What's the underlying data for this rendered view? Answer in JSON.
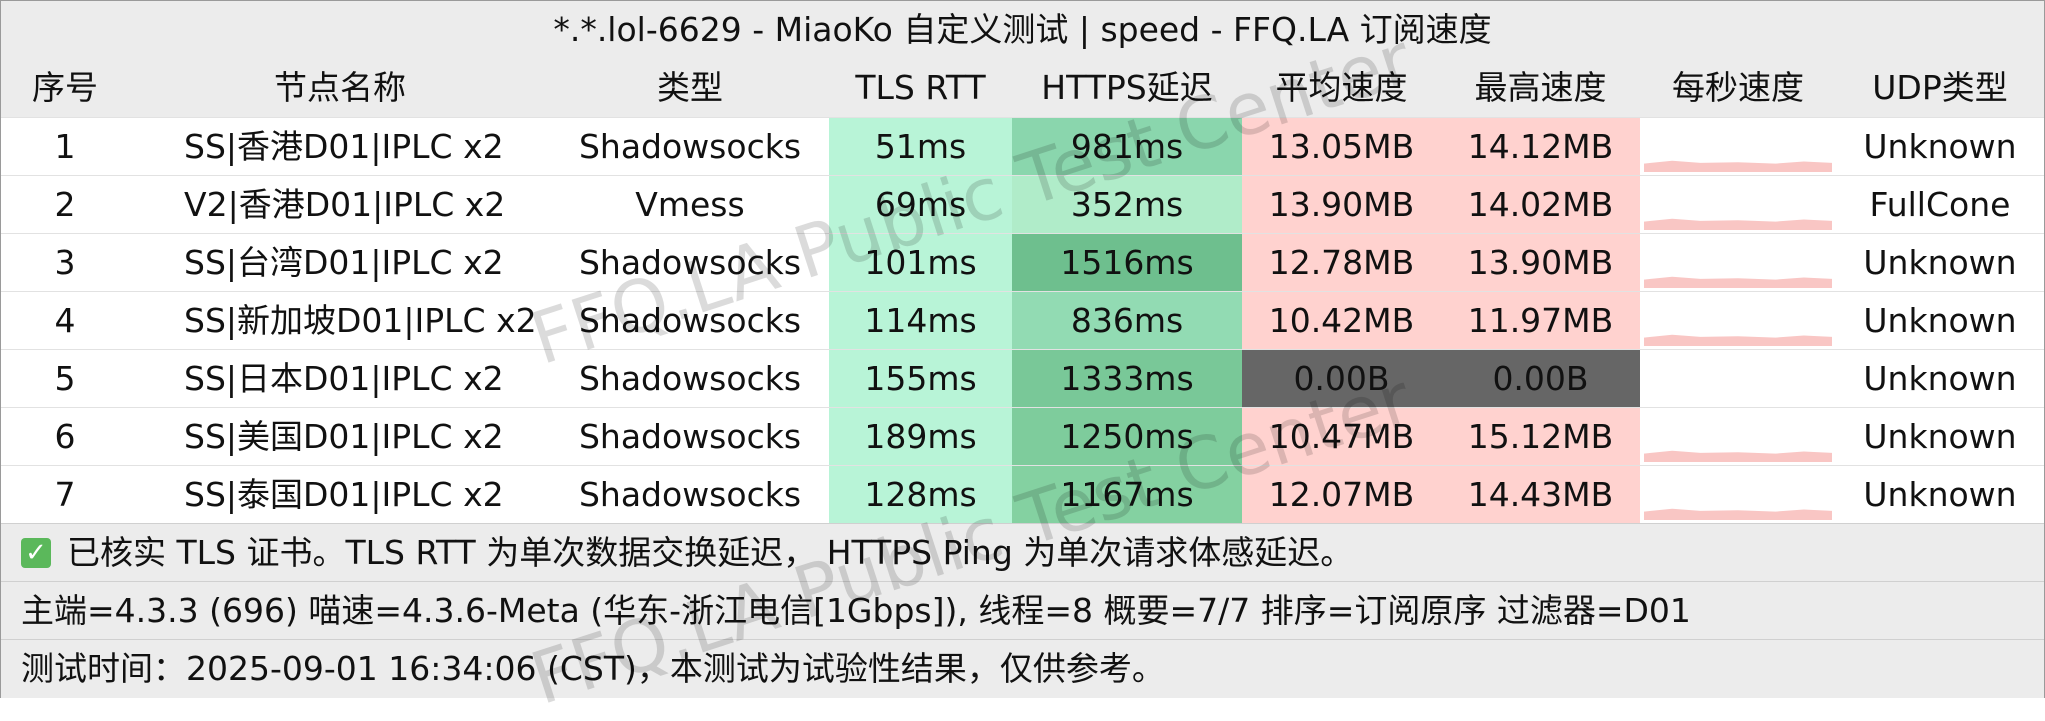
{
  "title": "*.*.lol-6629 - MiaoKo 自定义测试 | speed - FFQ.LA 订阅速度",
  "headers": [
    "序号",
    "节点名称",
    "类型",
    "TLS RTT",
    "HTTPS延迟",
    "平均速度",
    "最高速度",
    "每秒速度",
    "UDP类型"
  ],
  "rows": [
    {
      "idx": "1",
      "flag": "hk",
      "name": "SS|香港D01|IPLC x2",
      "type": "Shadowsocks",
      "tls": "51ms",
      "https": "981ms",
      "avg": "13.05MB",
      "max": "14.12MB",
      "udp": "Unknown",
      "tlsColor": "#b8f4d7",
      "httpsColor": "#8ad6ad",
      "avgColor": "#ffd2cf",
      "maxColor": "#ffd2cf",
      "zero": false
    },
    {
      "idx": "2",
      "flag": "hk",
      "name": "V2|香港D01|IPLC x2",
      "type": "Vmess",
      "tls": "69ms",
      "https": "352ms",
      "avg": "13.90MB",
      "max": "14.02MB",
      "udp": "FullCone",
      "tlsColor": "#b8f4d7",
      "httpsColor": "#b0ecc9",
      "avgColor": "#ffd2cf",
      "maxColor": "#ffd2cf",
      "zero": false
    },
    {
      "idx": "3",
      "flag": "tw",
      "name": "SS|台湾D01|IPLC x2",
      "type": "Shadowsocks",
      "tls": "101ms",
      "https": "1516ms",
      "avg": "12.78MB",
      "max": "13.90MB",
      "udp": "Unknown",
      "tlsColor": "#b8f4d7",
      "httpsColor": "#6ebf8e",
      "avgColor": "#ffd2cf",
      "maxColor": "#ffd2cf",
      "zero": false
    },
    {
      "idx": "4",
      "flag": "sg",
      "name": "SS|新加坡D01|IPLC x2",
      "type": "Shadowsocks",
      "tls": "114ms",
      "https": "836ms",
      "avg": "10.42MB",
      "max": "11.97MB",
      "udp": "Unknown",
      "tlsColor": "#b8f4d7",
      "httpsColor": "#92dbb3",
      "avgColor": "#ffd2cf",
      "maxColor": "#ffd2cf",
      "zero": false
    },
    {
      "idx": "5",
      "flag": "jp",
      "name": "SS|日本D01|IPLC x2",
      "type": "Shadowsocks",
      "tls": "155ms",
      "https": "1333ms",
      "avg": "0.00B",
      "max": "0.00B",
      "udp": "Unknown",
      "tlsColor": "#b8f4d7",
      "httpsColor": "#79c898",
      "avgColor": "#666666",
      "maxColor": "#666666",
      "zero": true
    },
    {
      "idx": "6",
      "flag": "us",
      "name": "SS|美国D01|IPLC x2",
      "type": "Shadowsocks",
      "tls": "189ms",
      "https": "1250ms",
      "avg": "10.47MB",
      "max": "15.12MB",
      "udp": "Unknown",
      "tlsColor": "#b8f4d7",
      "httpsColor": "#7ecc9c",
      "avgColor": "#ffd2cf",
      "maxColor": "#ffd2cf",
      "zero": false
    },
    {
      "idx": "7",
      "flag": "th",
      "name": "SS|泰国D01|IPLC x2",
      "type": "Shadowsocks",
      "tls": "128ms",
      "https": "1167ms",
      "avg": "12.07MB",
      "max": "14.43MB",
      "udp": "Unknown",
      "tlsColor": "#b8f4d7",
      "httpsColor": "#84d1a1",
      "avgColor": "#ffd2cf",
      "maxColor": "#ffd2cf",
      "zero": false
    }
  ],
  "footer": {
    "line1": "已核实 TLS 证书。TLS RTT 为单次数据交换延迟， HTTPS Ping 为单次请求体感延迟。",
    "line2": "主端=4.3.3 (696) 喵速=4.3.6-Meta (华东-浙江电信[1Gbps]), 线程=8 概要=7/7 排序=订阅原序 过滤器=D01",
    "line3": "测试时间：2025-09-01 16:34:06 (CST)，本测试为试验性结果，仅供参考。"
  },
  "watermark": "FFQ.LA Public Test Center",
  "colors": {
    "header_bg": "#ececec",
    "sparkline": "#f9c6c4"
  }
}
